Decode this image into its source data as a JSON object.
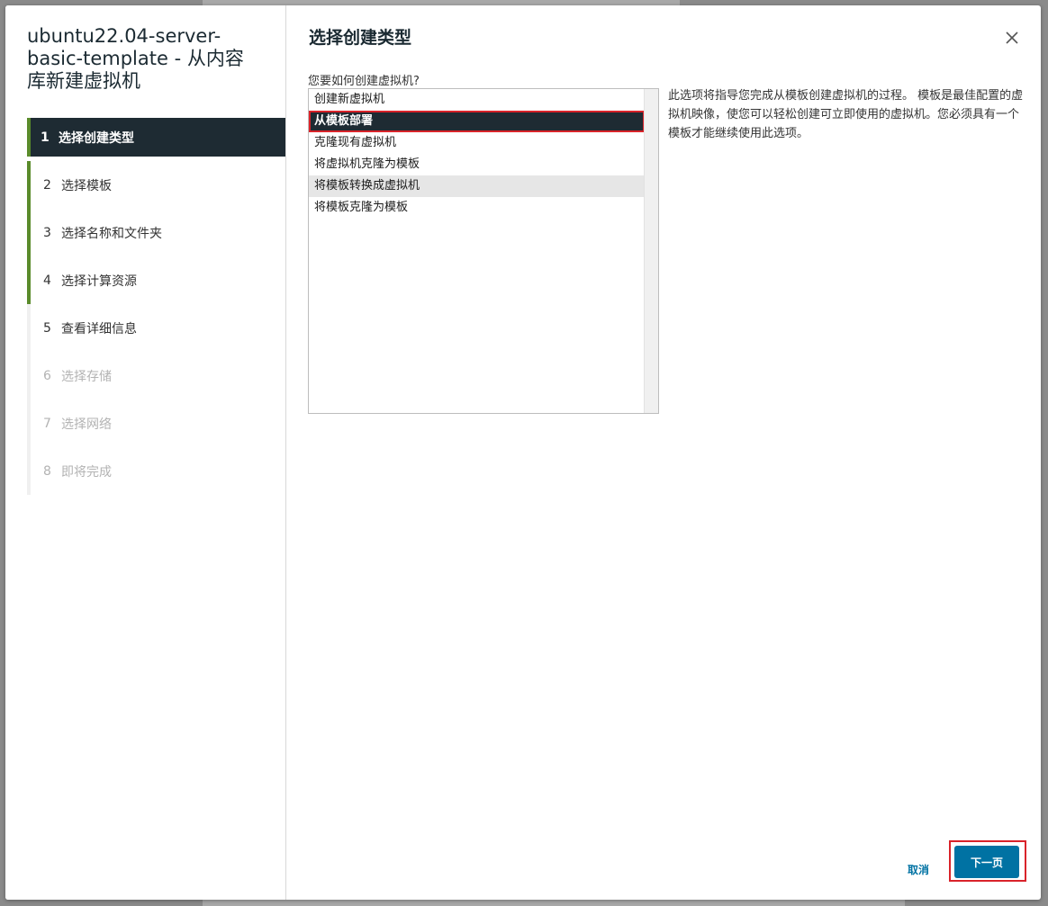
{
  "dialog": {
    "title": "ubuntu22.04-server-basic-template - 从内容库新建虚拟机"
  },
  "steps": [
    {
      "num": "1",
      "label": "选择创建类型",
      "state": "active"
    },
    {
      "num": "2",
      "label": "选择模板",
      "state": "done"
    },
    {
      "num": "3",
      "label": "选择名称和文件夹",
      "state": "done"
    },
    {
      "num": "4",
      "label": "选择计算资源",
      "state": "done"
    },
    {
      "num": "5",
      "label": "查看详细信息",
      "state": "current"
    },
    {
      "num": "6",
      "label": "选择存储",
      "state": "pending"
    },
    {
      "num": "7",
      "label": "选择网络",
      "state": "pending"
    },
    {
      "num": "8",
      "label": "即将完成",
      "state": "pending"
    }
  ],
  "content": {
    "page_title": "选择创建类型",
    "question": "您要如何创建虚拟机?",
    "options": [
      {
        "label": "创建新虚拟机",
        "state": "normal"
      },
      {
        "label": "从模板部署",
        "state": "selected"
      },
      {
        "label": "克隆现有虚拟机",
        "state": "normal"
      },
      {
        "label": "将虚拟机克隆为模板",
        "state": "normal"
      },
      {
        "label": "将模板转换成虚拟机",
        "state": "hover"
      },
      {
        "label": "将模板克隆为模板",
        "state": "normal"
      }
    ],
    "description": "此选项将指导您完成从模板创建虚拟机的过程。 模板是最佳配置的虚拟机映像，使您可以轻松创建可立即使用的虚拟机。您必须具有一个模板才能继续使用此选项。"
  },
  "footer": {
    "cancel_label": "取消",
    "next_label": "下一页"
  },
  "icons": {
    "close": "close-icon"
  },
  "colors": {
    "accent": "#0072a3",
    "selected_bg": "#1e2b33",
    "step_done": "#5a8b2b",
    "highlight": "#d9232a"
  }
}
